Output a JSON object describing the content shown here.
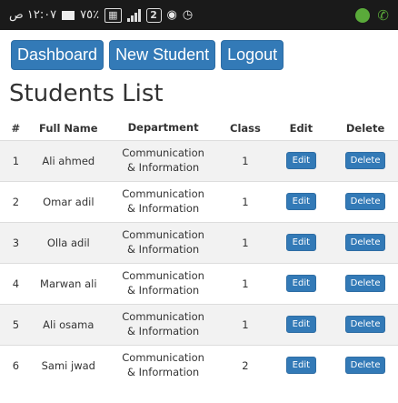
{
  "statusbar": {
    "time": "١٢:٠٧ ص",
    "battery_pct": "٧٥٪",
    "network_badge": "2"
  },
  "nav": {
    "dashboard": "Dashboard",
    "new_student": "New Student",
    "logout": "Logout"
  },
  "page": {
    "title": "Students List"
  },
  "table": {
    "headers": {
      "num": "#",
      "name": "Full Name",
      "department": "Department",
      "class": "Class",
      "edit": "Edit",
      "delete": "Delete"
    },
    "rows": [
      {
        "num": "1",
        "name": "Ali ahmed",
        "dept_line1": "Communication",
        "dept_line2": "& Information",
        "class": "1",
        "edit": "Edit",
        "delete": "Delete"
      },
      {
        "num": "2",
        "name": "Omar adil",
        "dept_line1": "Communication",
        "dept_line2": "& Information",
        "class": "1",
        "edit": "Edit",
        "delete": "Delete"
      },
      {
        "num": "3",
        "name": "Olla adil",
        "dept_line1": "Communication",
        "dept_line2": "& Information",
        "class": "1",
        "edit": "Edit",
        "delete": "Delete"
      },
      {
        "num": "4",
        "name": "Marwan ali",
        "dept_line1": "Communication",
        "dept_line2": "& Information",
        "class": "1",
        "edit": "Edit",
        "delete": "Delete"
      },
      {
        "num": "5",
        "name": "Ali osama",
        "dept_line1": "Communication",
        "dept_line2": "& Information",
        "class": "1",
        "edit": "Edit",
        "delete": "Delete"
      },
      {
        "num": "6",
        "name": "Sami jwad",
        "dept_line1": "Communication",
        "dept_line2": "& Information",
        "class": "2",
        "edit": "Edit",
        "delete": "Delete"
      }
    ]
  },
  "colors": {
    "primary": "#337ab7",
    "statusbar_bg": "#1a1a1a",
    "accent_green": "#5aaa3a"
  }
}
